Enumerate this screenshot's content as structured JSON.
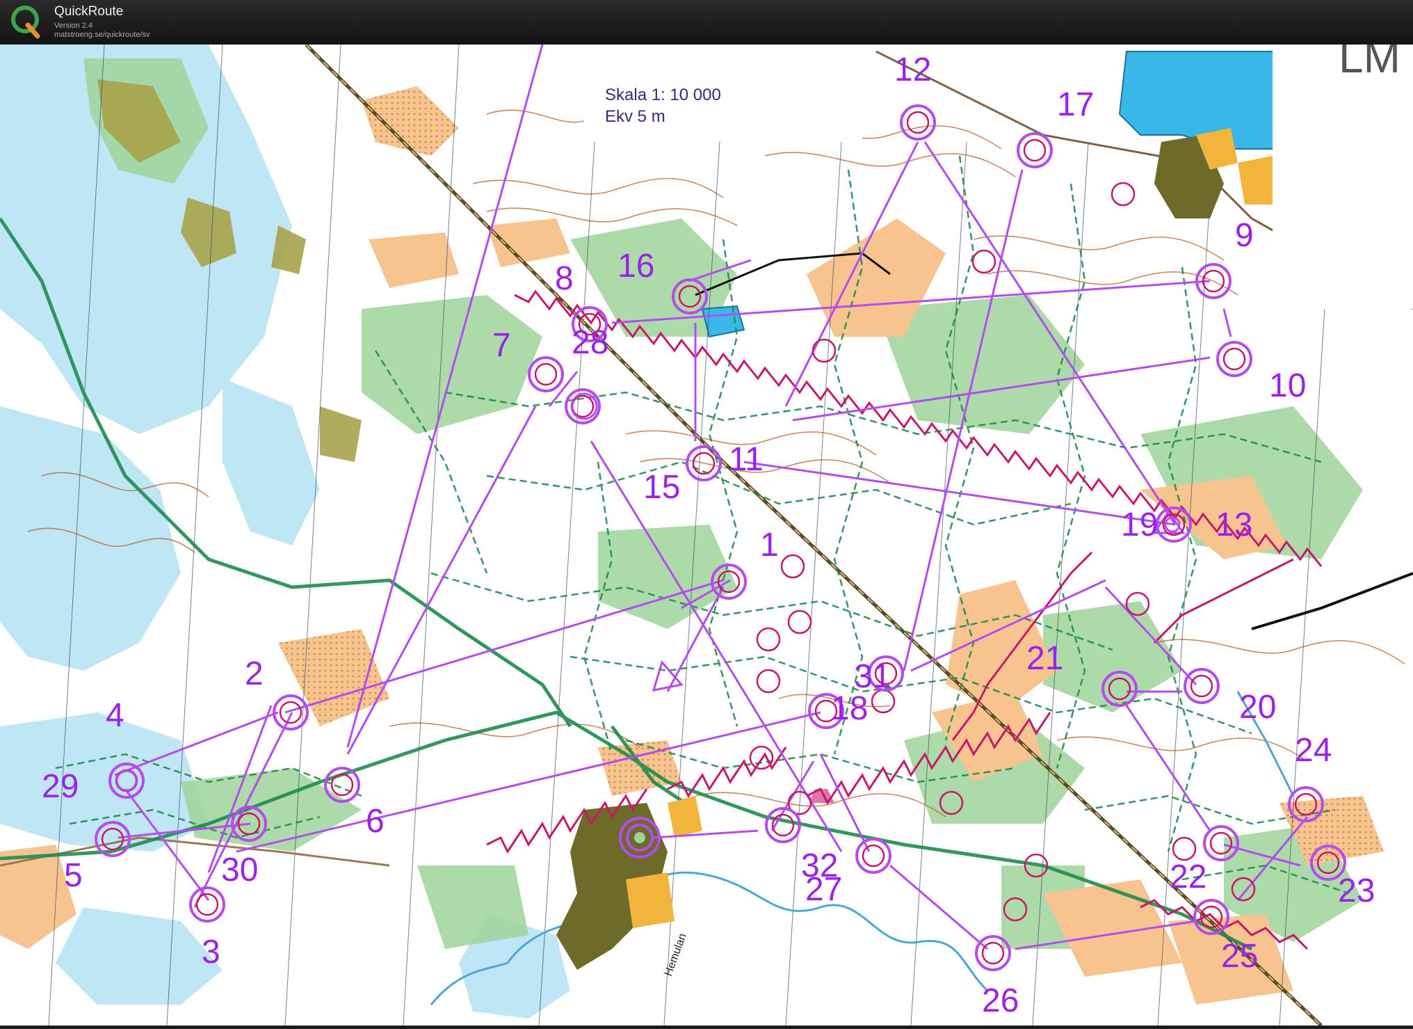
{
  "app": {
    "title": "QuickRoute",
    "version": "Version 2.4",
    "url": "matstroeng.se/quickroute/sv",
    "logo_letter": "Q"
  },
  "map": {
    "scale_line1": "Skala 1: 10 000",
    "scale_line2": "Ekv 5 m",
    "river_label": "Hemulan",
    "corner_text": "LM",
    "colors": {
      "course": "#b44cf0",
      "route_red": "#c8186c",
      "path_green": "#1d8c4c",
      "vegetation": "#9fd39a",
      "open_land": "#f7c48f",
      "water": "#bfe6f5",
      "lake": "#38b8e8",
      "contour": "#b8602a",
      "urban": "#6e6a2a"
    }
  },
  "controls": [
    {
      "label": "1"
    },
    {
      "label": "2"
    },
    {
      "label": "3"
    },
    {
      "label": "4"
    },
    {
      "label": "5"
    },
    {
      "label": "6"
    },
    {
      "label": "7"
    },
    {
      "label": "8"
    },
    {
      "label": "9"
    },
    {
      "label": "10"
    },
    {
      "label": "11"
    },
    {
      "label": "12"
    },
    {
      "label": "13"
    },
    {
      "label": "15"
    },
    {
      "label": "16"
    },
    {
      "label": "17"
    },
    {
      "label": "18"
    },
    {
      "label": "19"
    },
    {
      "label": "20"
    },
    {
      "label": "21"
    },
    {
      "label": "22"
    },
    {
      "label": "23"
    },
    {
      "label": "24"
    },
    {
      "label": "25"
    },
    {
      "label": "26"
    },
    {
      "label": "27"
    },
    {
      "label": "28"
    },
    {
      "label": "29"
    },
    {
      "label": "30"
    },
    {
      "label": "31"
    },
    {
      "label": "32"
    }
  ]
}
